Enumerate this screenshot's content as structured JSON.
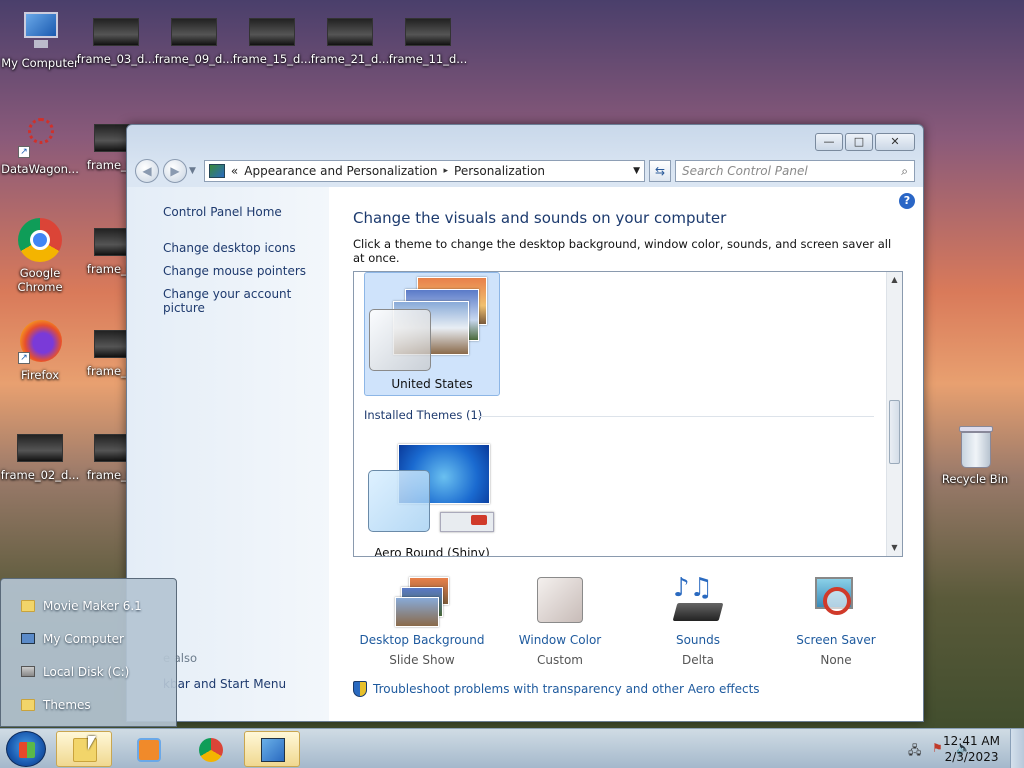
{
  "desktop": {
    "icons": [
      {
        "label": "My Computer"
      },
      {
        "label": "frame_03_d..."
      },
      {
        "label": "frame_09_d..."
      },
      {
        "label": "frame_15_d..."
      },
      {
        "label": "frame_21_d..."
      },
      {
        "label": "frame_11_d..."
      },
      {
        "label": "DataWagon..."
      },
      {
        "label": "frame_0..."
      },
      {
        "label": "Google Chrome"
      },
      {
        "label": "frame_0..."
      },
      {
        "label": "Firefox"
      },
      {
        "label": "frame_0..."
      },
      {
        "label": "frame_02_d..."
      },
      {
        "label": "frame_0..."
      },
      {
        "label": "Recycle Bin"
      }
    ]
  },
  "window": {
    "controls": {
      "minimize": "—",
      "maximize": "□",
      "close": "✕"
    },
    "nav": {
      "back": "◀",
      "forward": "▶"
    },
    "address": {
      "prefix": "«",
      "crumbs": [
        "Appearance and Personalization",
        "Personalization"
      ],
      "sep": "▸",
      "drop": "▼"
    },
    "refresh": "⇆",
    "search": {
      "placeholder": "Search Control Panel",
      "icon": "⌕"
    },
    "left_pane": {
      "home": "Control Panel Home",
      "links": [
        "Change desktop icons",
        "Change mouse pointers",
        "Change your account picture"
      ],
      "see_also": "e also",
      "taskbar_link": "kbar and Start Menu"
    },
    "main": {
      "help": "?",
      "heading": "Change the visuals and sounds on your computer",
      "subheading": "Click a theme to change the desktop background, window color, sounds, and screen saver all at once.",
      "themes": [
        {
          "label": "United States",
          "selected": true
        },
        {
          "label": "Aero Round (Shiny)",
          "selected": false
        }
      ],
      "installed_header": "Installed Themes (1)",
      "scroll": {
        "up": "▲",
        "down": "▼"
      },
      "bottom": [
        {
          "name": "Desktop Background",
          "sub": "Slide Show",
          "icon": "wallpaper-stack-icon"
        },
        {
          "name": "Window Color",
          "sub": "Custom",
          "icon": "color-swatch-icon"
        },
        {
          "name": "Sounds",
          "sub": "Delta",
          "icon": "sounds-icon"
        },
        {
          "name": "Screen Saver",
          "sub": "None",
          "icon": "screen-saver-icon"
        }
      ],
      "troubleshoot": "Troubleshoot problems with transparency and other Aero effects"
    }
  },
  "jumplist": {
    "items": [
      "Movie Maker 6.1",
      "My Computer",
      "Local Disk (C:)",
      "Themes"
    ]
  },
  "taskbar": {
    "clock_time": "12:41 AM",
    "clock_date": "2/3/2023",
    "tray": {
      "network": "🖧",
      "flag": "⚑",
      "volume": "🔊"
    }
  },
  "colors": {
    "link": "#1e5a9e",
    "heading": "#1c3a6e",
    "selected_tile": "#cfe3fb"
  }
}
